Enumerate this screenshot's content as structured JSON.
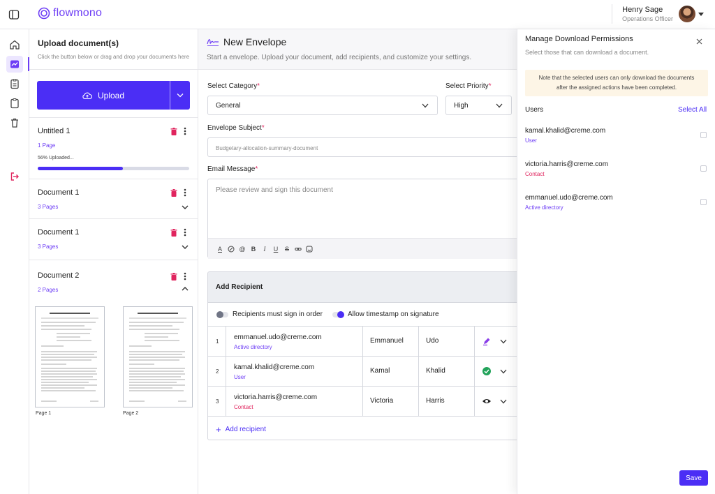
{
  "app": {
    "logo_text": "flowmono"
  },
  "user": {
    "name": "Henry Sage",
    "role": "Operations Officer"
  },
  "rail": {
    "items": [
      "home-icon",
      "activity-icon",
      "clipboard-list-icon",
      "clipboard-icon",
      "trash-icon",
      "logout-icon"
    ],
    "active_index": 1
  },
  "doc_panel": {
    "title": "Upload document(s)",
    "subtitle": "Click the button below or drag and drop your documents here",
    "upload_label": "Upload",
    "documents": [
      {
        "name": "Untitled 1",
        "pages": "1 Page",
        "progress_label": "56% Uploaded...",
        "progress": 0.56
      },
      {
        "name": "Document 1",
        "pages": "3 Pages"
      },
      {
        "name": "Document 1",
        "pages": "3 Pages"
      },
      {
        "name": "Document 2",
        "pages": "2 Pages",
        "expanded": true
      }
    ],
    "thumbnails": [
      "Page 1",
      "Page 2"
    ]
  },
  "envelope": {
    "title": "New Envelope",
    "subtitle": "Start a envelope. Upload your document, add recipients, and customize your settings.",
    "category_label": "Select Category",
    "category_value": "General",
    "priority_label": "Select Priority",
    "priority_value": "High",
    "subject_label": "Envelope Subject",
    "subject_value": "Budgetary-allocation-summary-document",
    "message_label": "Email Message",
    "message_placeholder": "Please review and sign this document",
    "required_mark": "*"
  },
  "recipients": {
    "header": "Add Recipient",
    "option_order": "Recipients must sign in order",
    "option_timestamp": "Allow timestamp on signature",
    "option_order_on": false,
    "option_timestamp_on": true,
    "rows": [
      {
        "num": "1",
        "email": "emmanuel.udo@creme.com",
        "type": "Active directory",
        "first": "Emmanuel",
        "last": "Udo",
        "action_icon": "sign-pen-icon"
      },
      {
        "num": "2",
        "email": "kamal.khalid@creme.com",
        "type": "User",
        "first": "Kamal",
        "last": "Khalid",
        "action_icon": "check-circle-icon"
      },
      {
        "num": "3",
        "email": "victoria.harris@creme.com",
        "type": "Contact",
        "first": "Victoria",
        "last": "Harris",
        "action_icon": "eye-icon"
      }
    ],
    "add_label": "Add recipient"
  },
  "download_panel": {
    "title": "Manage Download Permissions",
    "subtitle": "Select those that can download a document.",
    "note_line1": "Note that the selected users can only download the documents",
    "note_line2": "after the assigned actions have been completed.",
    "users_label": "Users",
    "select_all": "Select All",
    "users": [
      {
        "email": "kamal.khalid@creme.com",
        "type": "User"
      },
      {
        "email": "victoria.harris@creme.com",
        "type": "Contact"
      },
      {
        "email": "emmanuel.udo@creme.com",
        "type": "Active directory"
      }
    ],
    "save_label": "Save"
  },
  "colors": {
    "accent": "#4b2ef5",
    "brand": "#6d3df5",
    "danger": "#e0245e",
    "success": "#22a35a",
    "note_bg": "#fdf5e6"
  }
}
